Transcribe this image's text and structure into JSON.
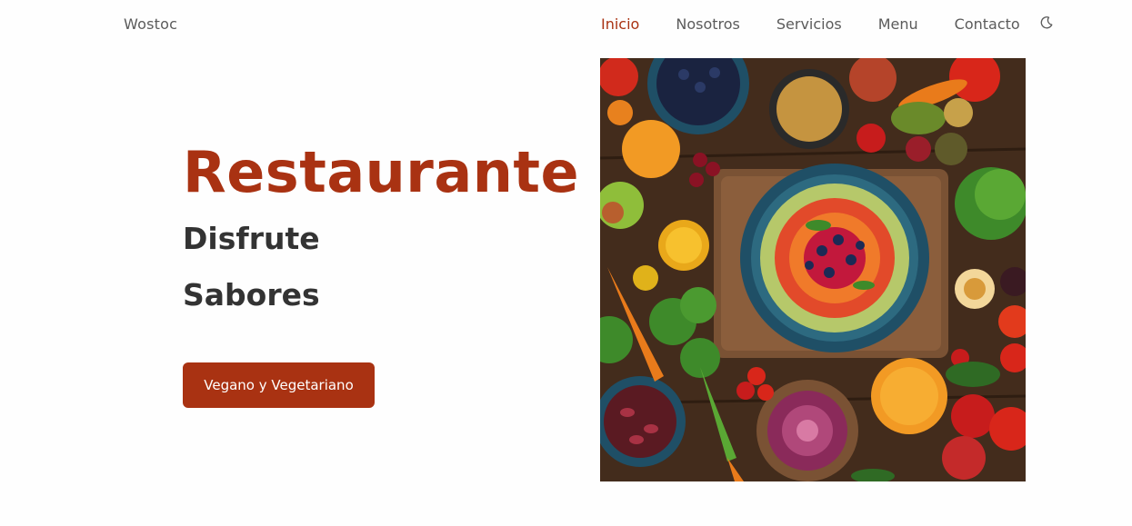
{
  "nav": {
    "brand": "Wostoc",
    "items": [
      {
        "label": "Inicio",
        "active": true
      },
      {
        "label": "Nosotros",
        "active": false
      },
      {
        "label": "Servicios",
        "active": false
      },
      {
        "label": "Menu",
        "active": false
      },
      {
        "label": "Contacto",
        "active": false
      }
    ],
    "theme_icon": "moon-icon"
  },
  "hero": {
    "title": "Restaurante",
    "subtitle_line1": "Disfrute",
    "subtitle_line2": "Sabores",
    "cta_label": "Vegano y Vegetariano",
    "image_icon": "food-platter-image"
  },
  "colors": {
    "accent": "#a93212",
    "text_dark": "#333333",
    "nav_text": "#5b5b5b",
    "background": "#fefefe"
  }
}
